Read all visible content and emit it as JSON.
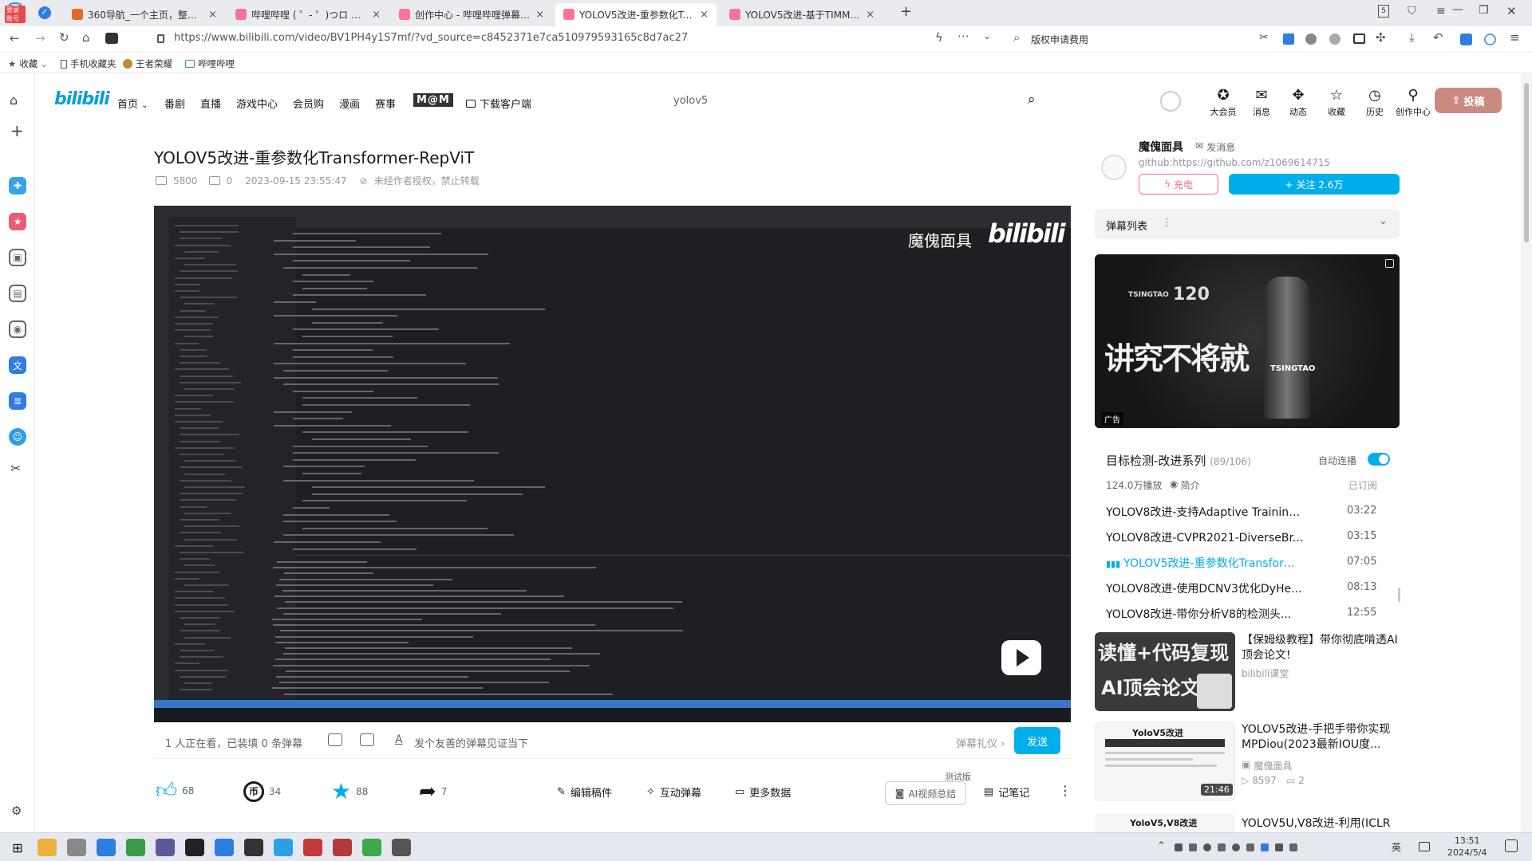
{
  "browser": {
    "badge": "登录账号",
    "tabs": [
      {
        "label": "360导航_一个主页，整个世界",
        "color": "#e26b2b"
      },
      {
        "label": "哔哩哔哩 ( ゜- ゜)つロ 干杯~-b",
        "color": "#fb7299"
      },
      {
        "label": "创作中心 - 哔哩哔哩弹幕视频",
        "color": "#fb7299"
      },
      {
        "label": "YOLOV5改进-重参数化Trans",
        "color": "#fb7299"
      },
      {
        "label": "YOLOV5改进-基于TIMM更换",
        "color": "#fb7299"
      }
    ],
    "tab_count": "5",
    "url": "https://www.bilibili.com/video/BV1PH4y1S7mf/?vd_source=c8452371e7ca510979593165c8d7ac27",
    "url_host": "www.bilibili.com",
    "search_hint": "版权申请费用",
    "bookmarks": [
      "收藏",
      "手机收藏夹",
      "王者荣耀",
      "哔哩哔哩"
    ]
  },
  "nav": {
    "logo": "bilibili",
    "items": [
      "首页",
      "番剧",
      "直播",
      "游戏中心",
      "会员购",
      "漫画",
      "赛事"
    ],
    "special": "M@M",
    "download": "下载客户端",
    "search_value": "yolov5",
    "icons": [
      {
        "label": "大会员",
        "icon": "vip-icon"
      },
      {
        "label": "消息",
        "icon": "message-icon"
      },
      {
        "label": "动态",
        "icon": "dynamic-icon"
      },
      {
        "label": "收藏",
        "icon": "favorite-icon"
      },
      {
        "label": "历史",
        "icon": "history-icon"
      },
      {
        "label": "创作中心",
        "icon": "creator-icon"
      }
    ],
    "upload": "投稿"
  },
  "video": {
    "title": "YOLOV5改进-重参数化Transformer-RepViT",
    "views": "5800",
    "danmaku": "0",
    "date": "2023-09-15 23:55:47",
    "copyright": "未经作者授权，禁止转载",
    "watermark_name": "魔傀面具",
    "watermark_logo": "bilibili",
    "watching": "1 人正在看，已装填 0 条弹幕",
    "danmaku_placeholder": "发个友善的弹幕见证当下",
    "danmaku_etiquette": "弹幕礼仪 ›",
    "send": "发送"
  },
  "actions": {
    "like": "68",
    "coin": "34",
    "fav": "88",
    "share": "7",
    "edit": "编辑稿件",
    "interact": "互动弹幕",
    "data": "更多数据",
    "ai_badge": "测试版",
    "ai": "AI视频总结",
    "notes": "记笔记"
  },
  "uploader": {
    "name": "魔傀面具",
    "msg": "发消息",
    "desc": "github:https://github.com/z1069614715",
    "charge": "充电",
    "follow": "+ 关注 2.6万"
  },
  "danmaku_list": {
    "title": "弹幕列表"
  },
  "ad": {
    "brand": "TSINGTAO",
    "badge": "120",
    "slogan": "讲究不将就",
    "tag": "广告"
  },
  "playlist": {
    "title": "目标检测-改进系列",
    "progress": "(89/106)",
    "autoplay": "自动连播",
    "plays": "124.0万播放",
    "intro": "简介",
    "subscribed": "已订阅",
    "episodes": [
      {
        "title": "YOLOV8改进-支持Adaptive Training...",
        "dur": "03:22",
        "current": false
      },
      {
        "title": "YOLOV8改进-CVPR2021-DiverseBr...",
        "dur": "03:15",
        "current": false
      },
      {
        "title": "YOLOV5改进-重参数化Transform...",
        "dur": "07:05",
        "current": true
      },
      {
        "title": "YOLOV8改进-使用DCNV3优化DyHe...",
        "dur": "08:13",
        "current": false
      },
      {
        "title": "YOLOV8改进-带你分析V8的检测头...",
        "dur": "12:55",
        "current": false
      }
    ]
  },
  "recommend": [
    {
      "title": "【保姆级教程】带你彻底啃透AI顶会论文!",
      "author": "bilibili课堂",
      "thumb_line1": "读懂+代码复现",
      "thumb_line2": "AI顶会论文",
      "views": "",
      "comments": "",
      "dur": ""
    },
    {
      "title": "YOLOV5改进-手把手带你实现MPDiou(2023最新IOU度...",
      "author": "魔傀面具",
      "thumb_line1": "YoloV5改进",
      "thumb_line2": "",
      "views": "8597",
      "comments": "2",
      "dur": "21:46"
    },
    {
      "title": "YOLOV5U,V8改进-利用(ICLR",
      "author": "",
      "thumb_line1": "YoloV5,V8改进",
      "thumb_line2": "",
      "views": "",
      "comments": "",
      "dur": ""
    }
  ],
  "taskbar": {
    "time": "13:51",
    "date": "2024/5/4",
    "lang": "英",
    "apps": [
      "windows-icon",
      "explorer-icon",
      "app-icon",
      "chrome-icon",
      "browser360-icon",
      "snip-icon",
      "pycharm-icon",
      "vscode-icon",
      "obs-icon",
      "kugou-icon",
      "youdao-icon",
      "filezilla-icon",
      "wechat-icon",
      "settings-icon"
    ]
  }
}
